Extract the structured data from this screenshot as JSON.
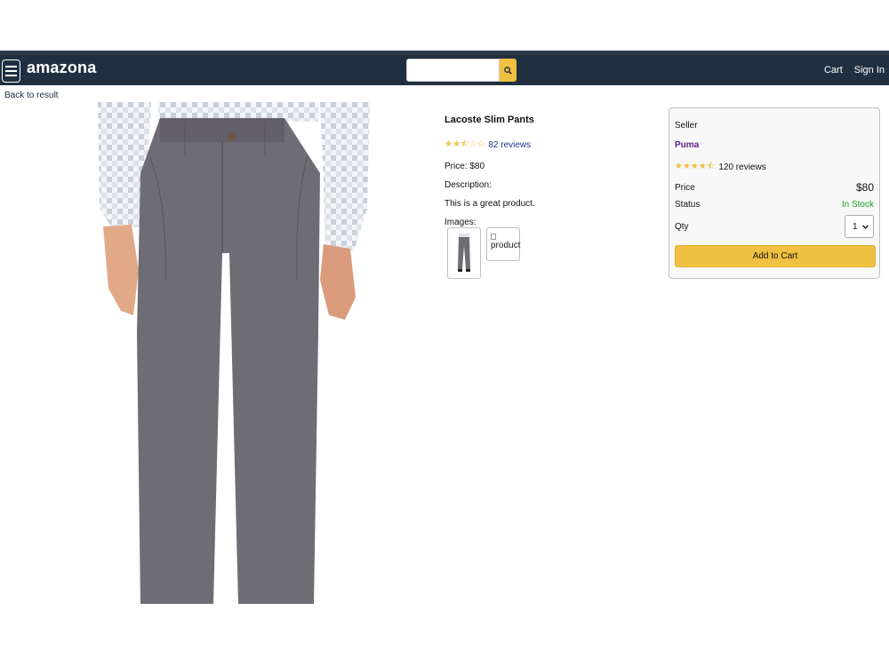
{
  "header": {
    "brand": "amazona",
    "search_placeholder": "",
    "nav": {
      "cart": "Cart",
      "signin": "Sign In"
    }
  },
  "back_link": "Back to result",
  "product": {
    "name": "Lacoste Slim Pants",
    "rating": 2.5,
    "reviews": "82 reviews",
    "price_line": "Price: $80",
    "description_label": "Description:",
    "description": "This is a great product.",
    "images_label": "Images:",
    "broken_thumb_alt": "product"
  },
  "seller_card": {
    "seller_label": "Seller",
    "seller_name": "Puma",
    "seller_rating": 4.5,
    "seller_reviews": "120 reviews",
    "price_label": "Price",
    "price_value": "$80",
    "status_label": "Status",
    "status_value": "In Stock",
    "qty_label": "Qty",
    "qty_value": "1",
    "add_to_cart": "Add to Cart"
  },
  "colors": {
    "header_bg": "#203040",
    "accent": "#f0c040",
    "in_stock": "#20a020",
    "seller_link": "#602090"
  }
}
